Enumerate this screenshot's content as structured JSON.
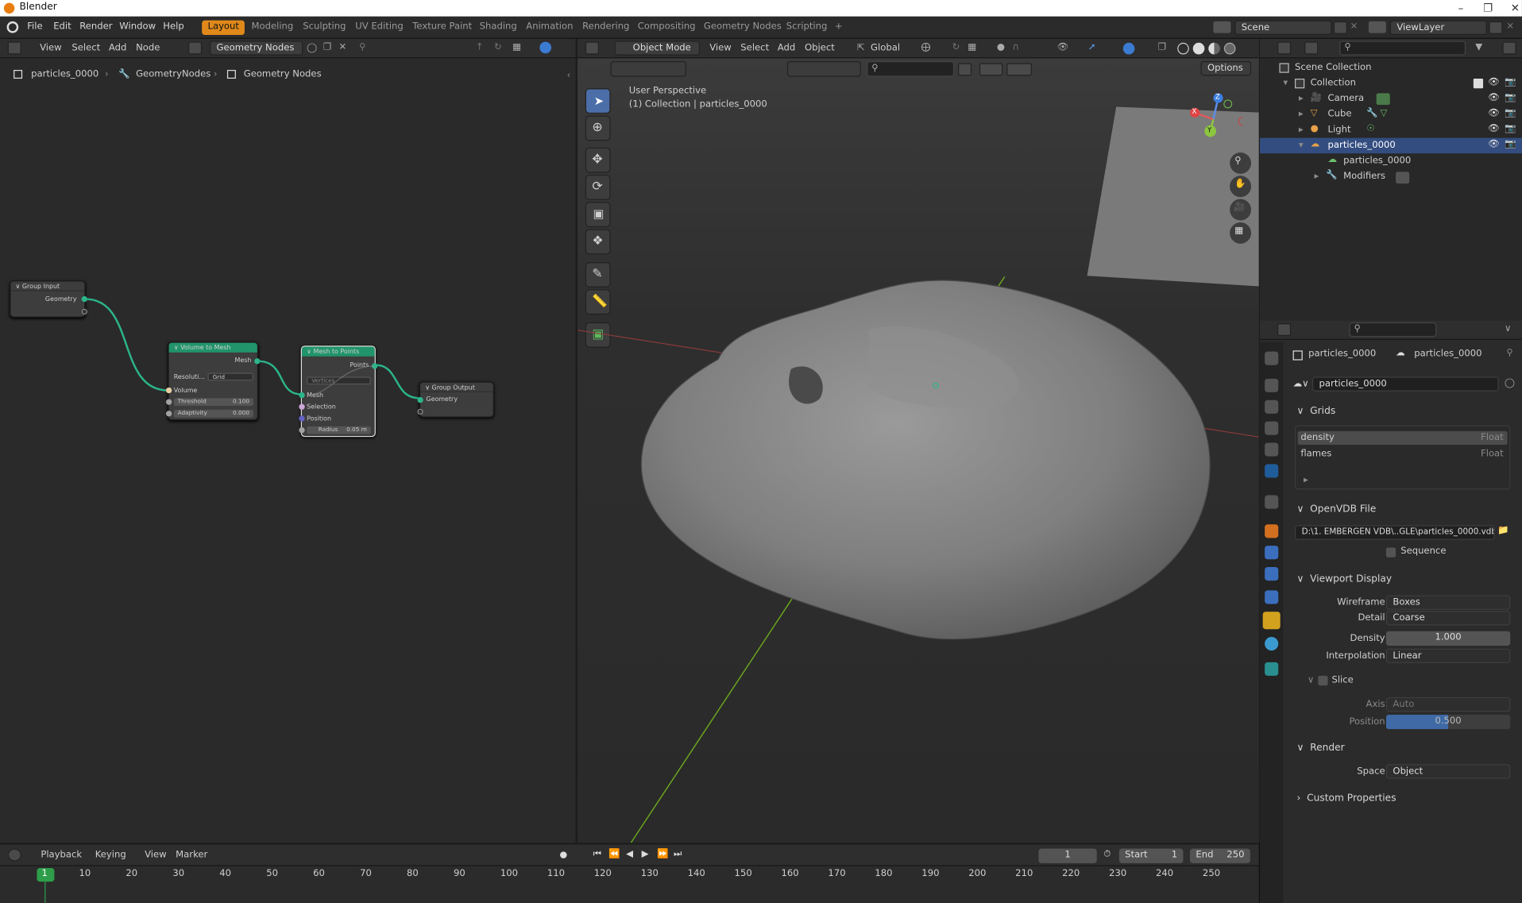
{
  "app": {
    "title": "Blender"
  },
  "menubar": {
    "menus": [
      "File",
      "Edit",
      "Render",
      "Window",
      "Help"
    ],
    "workspaces": [
      "Layout",
      "Modeling",
      "Sculpting",
      "UV Editing",
      "Texture Paint",
      "Shading",
      "Animation",
      "Rendering",
      "Compositing",
      "Geometry Nodes",
      "Scripting"
    ],
    "add_workspace": "+",
    "scene": "Scene",
    "view_layer": "ViewLayer"
  },
  "node_editor": {
    "menus": [
      "View",
      "Select",
      "Add",
      "Node"
    ],
    "node_tree": "Geometry Nodes",
    "breadcrumb": [
      "particles_0000",
      "GeometryNodes",
      "Geometry Nodes"
    ],
    "nodes": {
      "group_input": {
        "title": "Group Input",
        "output": "Geometry"
      },
      "volume_to_mesh": {
        "title": "Volume to Mesh",
        "output": "Mesh",
        "resolution_label": "Resoluti...",
        "resolution_value": "Grid",
        "input": "Volume",
        "threshold_label": "Threshold",
        "threshold_value": "0.100",
        "adaptivity_label": "Adaptivity",
        "adaptivity_value": "0.000"
      },
      "mesh_to_points": {
        "title": "Mesh to Points",
        "output": "Points",
        "mode": "Vertices",
        "inputs": [
          "Mesh",
          "Selection",
          "Position"
        ],
        "radius_label": "Radius",
        "radius_value": "0.05 m"
      },
      "group_output": {
        "title": "Group Output",
        "input": "Geometry"
      }
    }
  },
  "viewport": {
    "mode": "Object Mode",
    "menus": [
      "View",
      "Select",
      "Add",
      "Object"
    ],
    "orientation": "Global",
    "options": "Options",
    "info_line1": "User Perspective",
    "info_line2": "(1) Collection | particles_0000",
    "gizmo": {
      "x": "X",
      "y": "Y",
      "z": "Z"
    }
  },
  "outliner": {
    "items": [
      {
        "label": "Scene Collection",
        "icon": "scene-collection-icon"
      },
      {
        "label": "Collection",
        "icon": "collection-icon"
      },
      {
        "label": "Camera",
        "icon": "camera-icon"
      },
      {
        "label": "Cube",
        "icon": "mesh-icon"
      },
      {
        "label": "Light",
        "icon": "light-icon"
      },
      {
        "label": "particles_0000",
        "icon": "volume-icon"
      },
      {
        "label": "particles_0000",
        "icon": "volume-data-icon"
      },
      {
        "label": "Modifiers",
        "icon": "wrench-icon"
      }
    ]
  },
  "properties": {
    "object_name": "particles_0000",
    "data_name": "particles_0000",
    "datablock": "particles_0000",
    "grids_title": "Grids",
    "grids": [
      {
        "name": "density",
        "type": "Float"
      },
      {
        "name": "flames",
        "type": "Float"
      }
    ],
    "openvdb_title": "OpenVDB File",
    "filepath": "D:\\1. EMBERGEN VDB\\..GLE\\particles_0000.vdb",
    "sequence_label": "Sequence",
    "viewport_display_title": "Viewport Display",
    "wireframe_label": "Wireframe",
    "wireframe_value": "Boxes",
    "detail_label": "Detail",
    "detail_value": "Coarse",
    "density_label": "Density",
    "density_value": "1.000",
    "interpolation_label": "Interpolation",
    "interpolation_value": "Linear",
    "slice_label": "Slice",
    "axis_label": "Axis",
    "axis_value": "Auto",
    "position_label": "Position",
    "position_value": "0.500",
    "render_title": "Render",
    "space_label": "Space",
    "space_value": "Object",
    "custom_props_title": "Custom Properties"
  },
  "timeline": {
    "menus": [
      "Playback",
      "Keying",
      "View",
      "Marker"
    ],
    "current_frame": "1",
    "start_label": "Start",
    "start_value": "1",
    "end_label": "End",
    "end_value": "250",
    "ticks": [
      "1",
      "10",
      "20",
      "30",
      "40",
      "50",
      "60",
      "70",
      "80",
      "90",
      "100",
      "110",
      "120",
      "130",
      "140",
      "150",
      "160",
      "170",
      "180",
      "190",
      "200",
      "210",
      "220",
      "230",
      "240",
      "250"
    ]
  },
  "colors": {
    "accent": "#e0891a",
    "selection": "#334d80",
    "node_geometry": "#2bb58a",
    "node_mesh_header": "#21946b"
  }
}
